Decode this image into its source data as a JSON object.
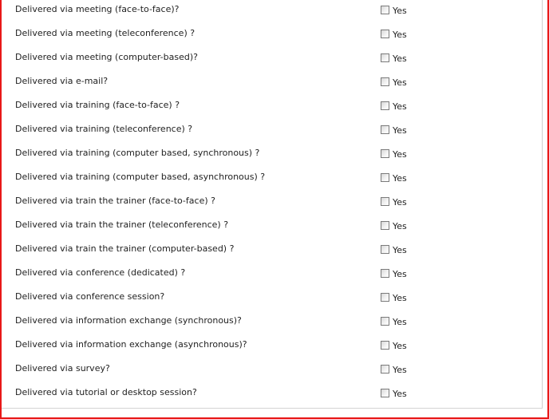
{
  "colors": {
    "frame_border": "#e81818",
    "text": "#222222",
    "checkbox_border": "#7b7b7b"
  },
  "option_label": "Yes",
  "questions": [
    {
      "label": "Delivered via meeting (face-to-face)?",
      "checked": false
    },
    {
      "label": "Delivered via meeting (teleconference) ?",
      "checked": false
    },
    {
      "label": "Delivered via meeting (computer-based)?",
      "checked": false
    },
    {
      "label": "Delivered via e-mail?",
      "checked": false
    },
    {
      "label": "Delivered via training (face-to-face) ?",
      "checked": false
    },
    {
      "label": "Delivered via training (teleconference) ?",
      "checked": false
    },
    {
      "label": "Delivered via training (computer based, synchronous) ?",
      "checked": false
    },
    {
      "label": "Delivered via training (computer based, asynchronous) ?",
      "checked": false
    },
    {
      "label": "Delivered via train the trainer (face-to-face) ?",
      "checked": false
    },
    {
      "label": "Delivered via train the trainer (teleconference) ?",
      "checked": false
    },
    {
      "label": "Delivered via train the trainer (computer-based) ?",
      "checked": false
    },
    {
      "label": "Delivered via conference (dedicated) ?",
      "checked": false
    },
    {
      "label": "Delivered via conference session?",
      "checked": false
    },
    {
      "label": "Delivered via information exchange (synchronous)?",
      "checked": false
    },
    {
      "label": "Delivered via information exchange (asynchronous)?",
      "checked": false
    },
    {
      "label": "Delivered via survey?",
      "checked": false
    },
    {
      "label": "Delivered via tutorial or desktop session?",
      "checked": false
    }
  ]
}
